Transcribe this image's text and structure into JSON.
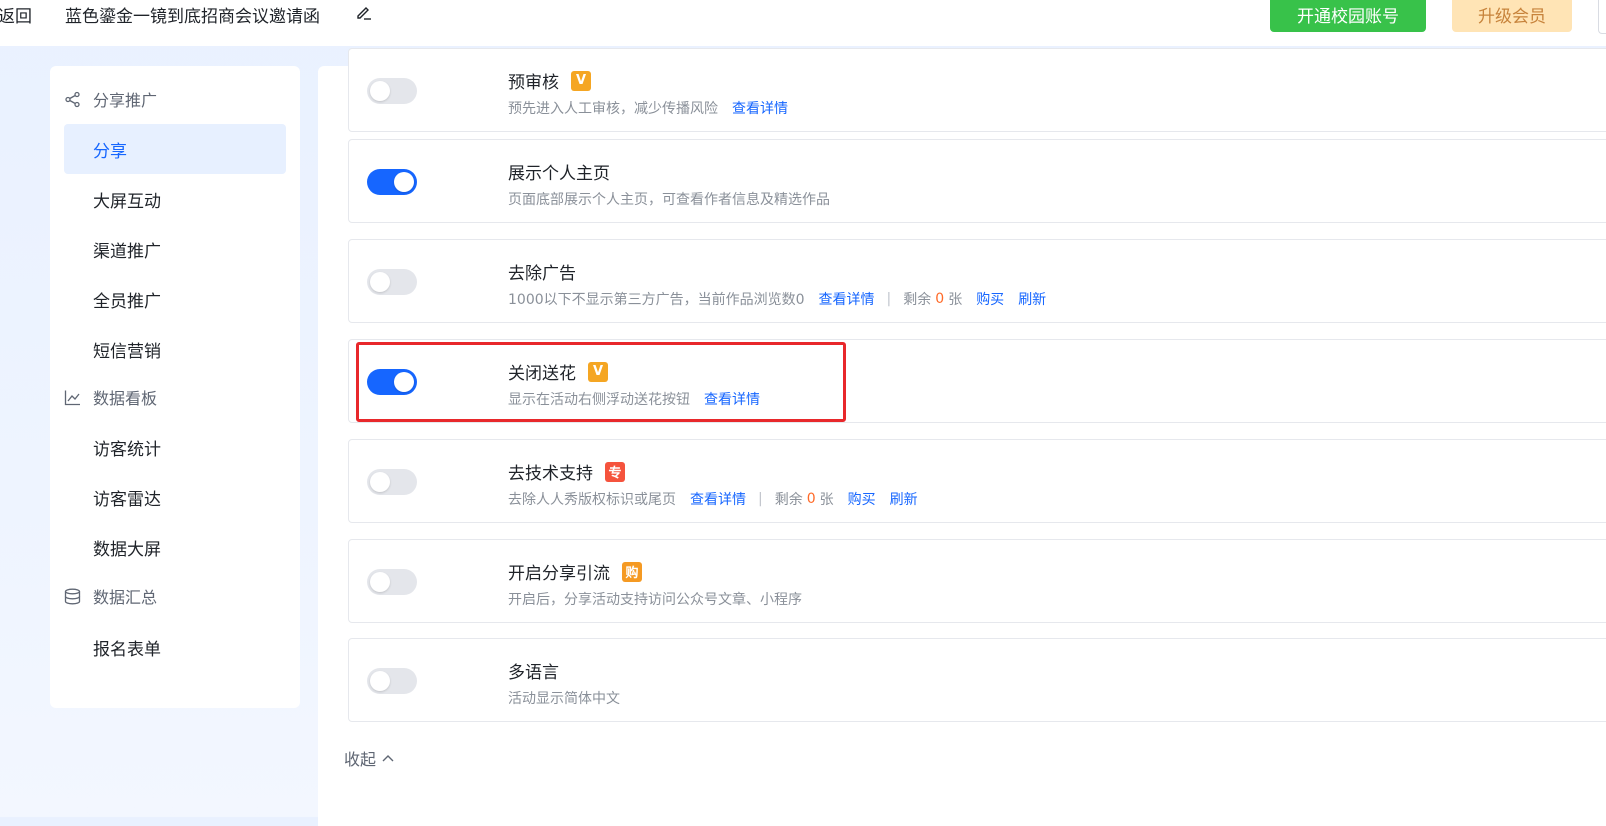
{
  "header": {
    "back_label": "返回",
    "title": "蓝色鎏金一镜到底招商会议邀请函",
    "edit_icon": "edit-icon",
    "campus_button": "开通校园账号",
    "vip_button": "升级会员"
  },
  "sidebar": {
    "groups": [
      {
        "label": "分享推广",
        "icon": "share-icon"
      },
      {
        "label": "数据看板",
        "icon": "chart-line-icon"
      },
      {
        "label": "数据汇总",
        "icon": "database-icon"
      }
    ],
    "items": [
      {
        "label": "分享",
        "active": true
      },
      {
        "label": "大屏互动"
      },
      {
        "label": "渠道推广"
      },
      {
        "label": "全员推广"
      },
      {
        "label": "短信营销"
      },
      {
        "label": "访客统计"
      },
      {
        "label": "访客雷达"
      },
      {
        "label": "数据大屏"
      },
      {
        "label": "报名表单"
      }
    ]
  },
  "settings": [
    {
      "title": "预审核",
      "tag": "V",
      "desc": "预先进入人工审核，减少传播风险",
      "link": "查看详情",
      "on": false
    },
    {
      "title": "展示个人主页",
      "desc": "页面底部展示个人主页，可查看作者信息及精选作品",
      "on": true
    },
    {
      "title": "去除广告",
      "desc": "1000以下不显示第三方广告，当前作品浏览数0",
      "link": "查看详情",
      "sep": "|",
      "remain_label": "剩余",
      "remain_count": "0",
      "remain_unit": "张",
      "buy": "购买",
      "refresh": "刷新",
      "on": false
    },
    {
      "title": "关闭送花",
      "tag": "V",
      "desc": "显示在活动右侧浮动送花按钮",
      "link": "查看详情",
      "on": true
    },
    {
      "title": "去技术支持",
      "tag": "专",
      "desc": "去除人人秀版权标识或尾页",
      "link": "查看详情",
      "sep": "|",
      "remain_label": "剩余",
      "remain_count": "0",
      "remain_unit": "张",
      "buy": "购买",
      "refresh": "刷新",
      "on": false
    },
    {
      "title": "开启分享引流",
      "tag": "购",
      "desc": "开启后，分享活动支持访问公众号文章、小程序",
      "on": false
    },
    {
      "title": "多语言",
      "desc": "活动显示简体中文",
      "on": false
    }
  ],
  "collapse_label": "收起",
  "colors": {
    "primary": "#1666ff",
    "green": "#38c24a",
    "vip_bg": "#ffe4b5",
    "highlight": "#e8282b"
  }
}
